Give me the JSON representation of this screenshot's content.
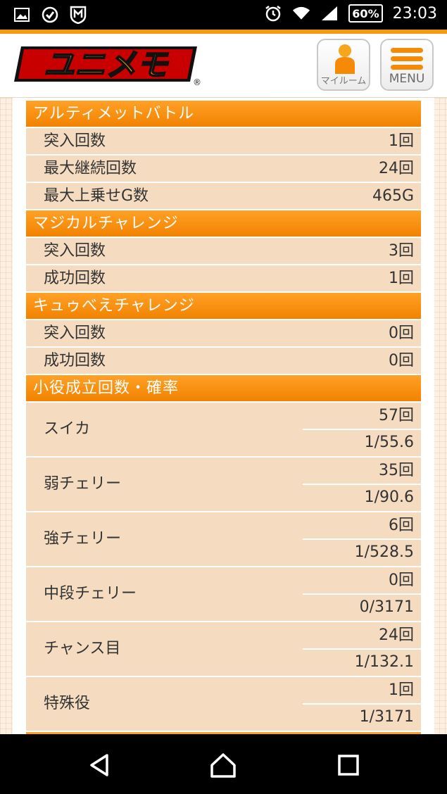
{
  "status_bar": {
    "left_icons": [
      "image-icon",
      "check-circle-icon",
      "shield-m-icon"
    ],
    "battery": "60%",
    "time": "23:03"
  },
  "header": {
    "logo_text": "ユニメモ",
    "logo_mark": "®",
    "myroom_label": "マイルーム",
    "menu_label": "MENU"
  },
  "sections": {
    "ultimate": {
      "title": "アルティメットバトル",
      "rows": [
        {
          "label": "突入回数",
          "value": "1回"
        },
        {
          "label": "最大継続回数",
          "value": "24回"
        },
        {
          "label": "最大上乗せG数",
          "value": "465G"
        }
      ]
    },
    "magical": {
      "title": "マジカルチャレンジ",
      "rows": [
        {
          "label": "突入回数",
          "value": "3回"
        },
        {
          "label": "成功回数",
          "value": "1回"
        }
      ]
    },
    "kyubey": {
      "title": "キュゥべえチャレンジ",
      "rows": [
        {
          "label": "突入回数",
          "value": "0回"
        },
        {
          "label": "成功回数",
          "value": "0回"
        }
      ]
    },
    "koyaku": {
      "title": "小役成立回数・確率",
      "rows": [
        {
          "label": "スイカ",
          "count": "57回",
          "ratio": "1/55.6"
        },
        {
          "label": "弱チェリー",
          "count": "35回",
          "ratio": "1/90.6"
        },
        {
          "label": "強チェリー",
          "count": "6回",
          "ratio": "1/528.5"
        },
        {
          "label": "中段チェリー",
          "count": "0回",
          "ratio": "0/3171"
        },
        {
          "label": "チャンス目",
          "count": "24回",
          "ratio": "1/132.1"
        },
        {
          "label": "特殊役",
          "count": "1回",
          "ratio": "1/3171"
        }
      ]
    }
  },
  "nav": {
    "icons": [
      "back-icon",
      "home-icon",
      "recents-icon"
    ]
  },
  "colors": {
    "accent_orange": "#f28200",
    "row_bg": "#f5dcc1",
    "page_bg": "#fdf0e2"
  }
}
